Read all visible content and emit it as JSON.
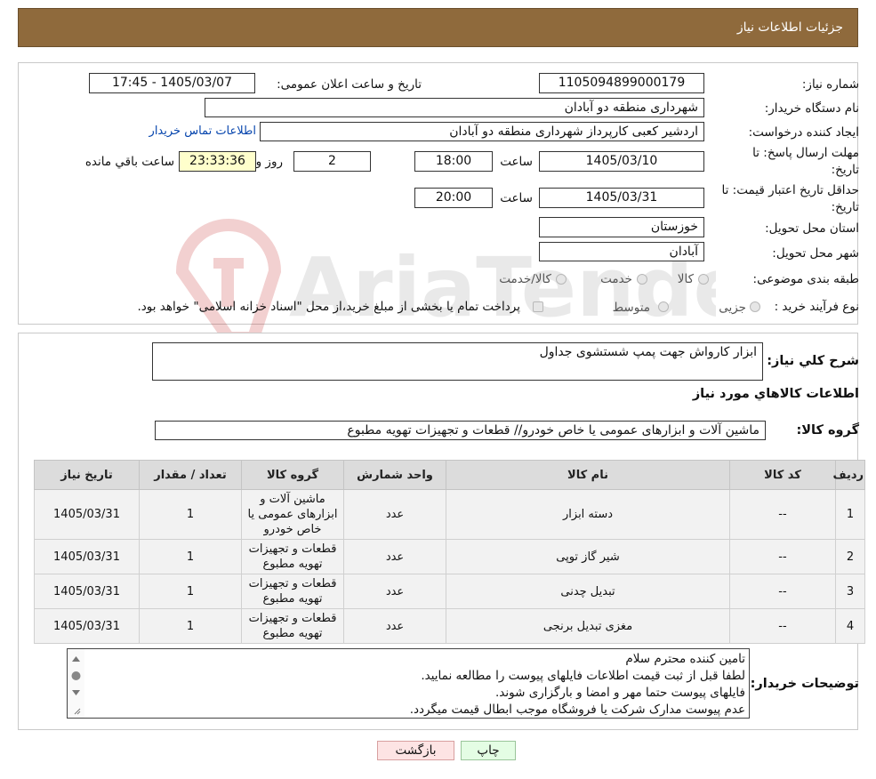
{
  "header": {
    "title": "جزئیات اطلاعات نیاز"
  },
  "info": {
    "need_number_label": "شماره نیاز:",
    "need_number": "1105094899000179",
    "announce_label": "تاریخ و ساعت اعلان عمومی:",
    "announce_value": "1405/03/07 - 17:45",
    "buyer_org_label": "نام دستگاه خریدار:",
    "buyer_org": "شهرداری منطقه دو آبادان",
    "requester_label": "ایجاد کننده درخواست:",
    "requester": "اردشیر کعبی کارپرداز شهرداری منطقه دو آبادان",
    "contact_link": "اطلاعات تماس خریدار",
    "deadline_label": "مهلت ارسال پاسخ: تا تاریخ:",
    "deadline_date": "1405/03/10",
    "time_label": "ساعت",
    "deadline_time": "18:00",
    "days_value": "2",
    "days_label": "روز و",
    "remaining_value": "23:33:36",
    "remaining_label": "ساعت باقي مانده",
    "validity_label": "حداقل تاریخ اعتبار قیمت: تا تاریخ:",
    "validity_date": "1405/03/31",
    "validity_time": "20:00",
    "province_label": "استان محل تحویل:",
    "province": "خوزستان",
    "city_label": "شهر محل تحویل:",
    "city": "آبادان",
    "category_label": "طبقه بندی موضوعی:",
    "category_options": [
      "کالا",
      "خدمت",
      "کالا/خدمت"
    ],
    "process_label": "نوع فرآیند خرید :",
    "process_options": [
      "جزیی",
      "متوسط"
    ],
    "process_note": "پرداخت تمام یا بخشی از مبلغ خرید،از محل \"اسناد خزانه اسلامی\" خواهد بود."
  },
  "description": {
    "label": "شرح کلي نياز:",
    "value": "ابزار کارواش جهت پمپ شستشوی جداول"
  },
  "goods": {
    "section_title": "اطلاعات کالاهاي مورد نياز",
    "group_label": "گروه کالا:",
    "group_value": "ماشین آلات و ابزارهای عمومی یا خاص خودرو//  قطعات و تجهیزات تهویه مطبوع",
    "columns": [
      "ردیف",
      "کد کالا",
      "نام کالا",
      "واحد شمارش",
      "گروه کالا",
      "تعداد / مقدار",
      "تاریخ نیاز"
    ],
    "rows": [
      [
        "1",
        "--",
        "دسته ابزار",
        "عدد",
        "ماشین آلات و ابزارهای عمومی یا خاص خودرو",
        "1",
        "1405/03/31"
      ],
      [
        "2",
        "--",
        "شیر گاز توپی",
        "عدد",
        "قطعات و تجهیزات تهویه مطبوع",
        "1",
        "1405/03/31"
      ],
      [
        "3",
        "--",
        "تبدیل چدنی",
        "عدد",
        "قطعات و تجهیزات تهویه مطبوع",
        "1",
        "1405/03/31"
      ],
      [
        "4",
        "--",
        "مغزی تبدیل برنجی",
        "عدد",
        "قطعات و تجهیزات تهویه مطبوع",
        "1",
        "1405/03/31"
      ]
    ]
  },
  "buyer_notes": {
    "label": "توضیحات خریدار:",
    "lines": [
      "تامین کننده محترم سلام",
      "لطفا قبل از ثبت قیمت اطلاعات فایلهای پیوست را مطالعه نمایید.",
      "فایلهای پیوست حتما مهر و امضا و بارگزاری شوند.",
      "عدم پیوست مدارک شرکت یا فروشگاه موجب ابطال قیمت میگردد."
    ]
  },
  "buttons": {
    "back": "بازگشت",
    "print": "چاپ"
  },
  "watermark": {
    "text": "AriaTender.neT"
  },
  "colors": {
    "header_bg": "#8f6a3c",
    "remaining_bg": "#ffffcc",
    "back_btn_bg": "#fde4e4",
    "print_btn_bg": "#e4fde4"
  }
}
